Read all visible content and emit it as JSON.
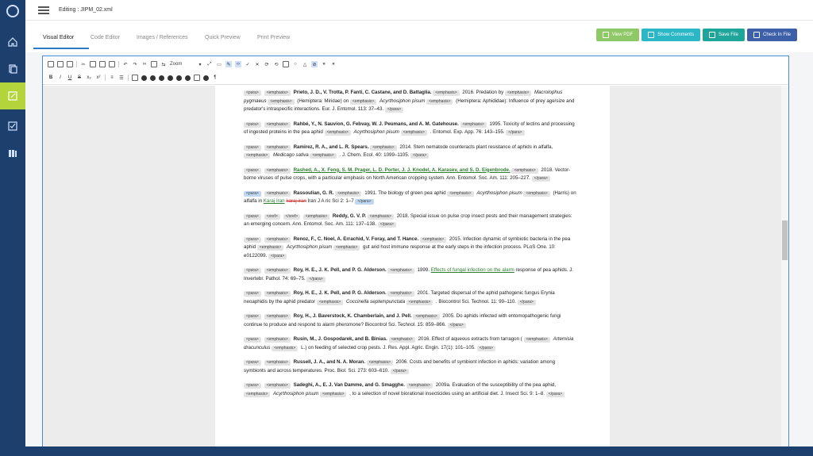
{
  "header": {
    "doc_title": "Editing : JIPM_02.xml"
  },
  "tabs": [
    "Visual Editor",
    "Code Editor",
    "Images / References",
    "Quick Preview",
    "Print Preview"
  ],
  "actions": {
    "view_pdf": "View PDF",
    "show_comments": "Show Comments",
    "save_file": "Save File",
    "check_in": "Check In File"
  },
  "colors": {
    "sidebar": "#1d3f6e",
    "active_side": "#b3d43a",
    "view_pdf": "#8fc866",
    "show_comments": "#2bb7c6",
    "save_file": "#1fa59a",
    "check_in": "#3d5fa8"
  },
  "toolbar": {
    "zoom_label": "Zoom"
  },
  "tags": {
    "para": "<para>",
    "emphasis": "<emphasis>",
    "para_end": "</para>",
    "xref": "<xref>",
    "xref_end": "</xref>"
  },
  "refs": [
    {
      "author": "Prieto, J. D., V. Trotta, P. Fanti, C. Castane, and D. Battaglia.",
      "year": "2016. Predation by",
      "species": "Macrolophus pygmaeus",
      "rest": "(Hemiptera: Miridae) on",
      "species2": "Acyrthosiphon pisum",
      "rest2": "(Hemiptera: Aphididae): Influence of prey age/size and predator's intraspecific interactions. Eur. J. Entomol. 113: 37–43."
    },
    {
      "author": "Rahbé, Y., N. Sauvion, G. Febvay, W. J. Peumans, and A. M. Gatehouse.",
      "year": "1995. Toxicity of lectins and processing of ingested proteins in the pea aphid",
      "species": "Acyrthosiphon pisum",
      "rest": ". Entomol. Exp. App. 76: 143–155."
    },
    {
      "author": "Ramirez, R. A., and L. R. Spears.",
      "year": "2014. Stem nematode counteracts plant resistance of aphids in alfalfa,",
      "species": "Medicago sativa",
      "rest": ". J. Chem. Ecol. 40: 1099–1105."
    },
    {
      "author": "Rashed, A., X. Feng, S. M. Prager, L. D. Porter, J. J. Knodel, A. Karasev, and S. D. Eigenbrode.",
      "year": "2018. Vector-borne viruses of pulse crops, with a particular emphasis on North American cropping system. Ann. Entomol. Soc. Am. 111: 205–227."
    },
    {
      "author": "Rassoulian, G. R.",
      "year": "1991. The biology of green pea aphid",
      "species": "Acyrthosiphon pisum",
      "rest": "(Harris) on alfalfa in",
      "link": "Karaj Iran",
      "deleted": "karaj iran",
      "rest2": "Iran J A ric Sci 2: 1–7"
    },
    {
      "author": "Reddy, G. V. P.",
      "year": "2018. Special issue on pulse crop insect pests and their management strategies: an emerging concern. Ann. Entomol. Soc. Am. 111: 137–138."
    },
    {
      "author": "Renoz, F., C. Noel, A. Errachid, V. Foray, and T. Hance.",
      "year": "2015. Infection dynamic of symbiotic bacteria in the pea aphid",
      "species": "Acyrthosiphon pisum",
      "rest": "gut and host immune response at the early steps in the infection process. PLoS One. 10: e0122099."
    },
    {
      "author": "Roy, H. E., J. K. Pell, and P. G. Alderson.",
      "year": "1999.",
      "link": "Effects of fungal infection on the alarm",
      "rest": "response of pea aphids. J. Invertebr. Pathol. 74: 69–75."
    },
    {
      "author": "Roy, H. E., J. K. Pell, and P. G. Alderson.",
      "year": "2001. Targeted dispersal of the aphid pathogenic fungus Erynia neoaphidis by the aphid predator",
      "species": "Coccinella septempunctata",
      "rest": ". Biocontrol Sci. Technol. 11: 99–110."
    },
    {
      "author": "Roy, H., J. Baverstock, K. Chamberlain, and J. Pell.",
      "year": "2005. Do aphids infected with entomopathogenic fungi continue to produce and respond to alarm pheromone? Biocontrol Sci. Technol. 15: 859–866."
    },
    {
      "author": "Rusin, M., J. Gospodarek, and B. Binias.",
      "year": "2016. Effect of aqueous extracts from tarragon (",
      "species": "Artemisia dracunculus",
      "rest": "L.) on feeding of selected crop pests. J. Res. Appl. Agric. Engin. 17(1): 101–105."
    },
    {
      "author": "Russell, J. A., and N. A. Moran.",
      "year": "2006. Costs and benefits of symbiont infection in aphids: variation among symbionts and across temperatures. Proc. Biol. Sci. 273: 603–610."
    },
    {
      "author": "Sadeghi, A., E. J. Van Damme, and G. Smagghe.",
      "year": "2009a. Evaluation of the susceptibility of the pea aphid,",
      "species": "Acyrthosiphon pisum",
      "rest": ", to a selection of novel biorational insecticides using an artificial diet. J. Insect Sci. 9: 1–8."
    }
  ]
}
